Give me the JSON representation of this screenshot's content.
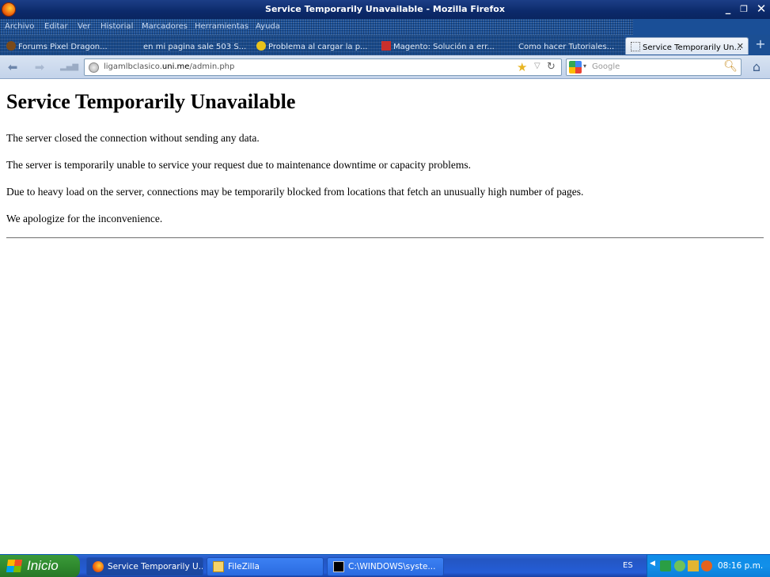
{
  "window": {
    "title": "Service Temporarily Unavailable - Mozilla Firefox"
  },
  "menubar": {
    "items": [
      "Archivo",
      "Editar",
      "Ver",
      "Historial",
      "Marcadores",
      "Herramientas",
      "Ayuda"
    ]
  },
  "tabs": [
    {
      "label": "Forums Pixel Dragon..."
    },
    {
      "label": "en mi pagina sale 503 S..."
    },
    {
      "label": "Problema al cargar la p..."
    },
    {
      "label": "Magento: Solución a err..."
    },
    {
      "label": "Como hacer Tutoriales..."
    },
    {
      "label": "Service Temporarily Un..."
    }
  ],
  "navbar": {
    "url_prefix": "ligamlbclasico.",
    "url_host": "uni.me",
    "url_path": "/admin.php",
    "search_placeholder": "Google"
  },
  "page": {
    "heading": "Service Temporarily Unavailable",
    "paragraphs": [
      "The server closed the connection without sending any data.",
      "The server is temporarily unable to service your request due to maintenance downtime or capacity problems.",
      "Due to heavy load on the server, connections may be temporarily blocked from locations that fetch an unusually high number of pages.",
      "We apologize for the inconvenience."
    ]
  },
  "taskbar": {
    "start_label": "Inicio",
    "tasks": [
      {
        "label": "Service Temporarily U..."
      },
      {
        "label": "FileZilla"
      },
      {
        "label": "C:\\WINDOWS\\syste..."
      }
    ],
    "language": "ES",
    "clock": "08:16 p.m."
  }
}
